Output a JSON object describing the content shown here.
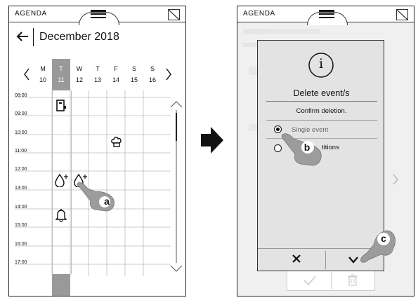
{
  "left_screen": {
    "title": "AGENDA",
    "month": "December 2018",
    "days": [
      {
        "letter": "M",
        "num": "10"
      },
      {
        "letter": "T",
        "num": "11"
      },
      {
        "letter": "W",
        "num": "12"
      },
      {
        "letter": "T",
        "num": "13"
      },
      {
        "letter": "F",
        "num": "14"
      },
      {
        "letter": "S",
        "num": "15"
      },
      {
        "letter": "S",
        "num": "16"
      }
    ],
    "times": [
      "08:00",
      "09:00",
      "10:00",
      "11:00",
      "12:00",
      "13:00",
      "14:00",
      "15:00",
      "16:00",
      "17:00"
    ],
    "callout": "a"
  },
  "right_screen": {
    "title": "AGENDA",
    "dialog": {
      "info_symbol": "i",
      "heading": "Delete event/s",
      "subheading": "Confirm deletion.",
      "option_single": "Single event",
      "option_repetitions_visible": "titions"
    },
    "callout_b": "b",
    "callout_c": "c"
  },
  "icons": {
    "left_arrow": "back-arrow-icon",
    "prev": "chevron-left-icon",
    "next": "chevron-right-icon"
  }
}
